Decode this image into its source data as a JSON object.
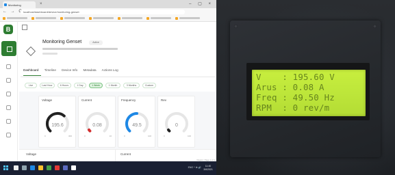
{
  "browser": {
    "tab_title": "Monitoring",
    "close_glyph": "×",
    "window_controls": "– ▢ ×",
    "nav_glyphs": "← → C",
    "url": "localhost/dashboard/device/monitoring-genset"
  },
  "app": {
    "logo_letter": "B",
    "device_title": "Monitoring Genset",
    "status_chip": "Active",
    "tabs": [
      {
        "label": "Dashboard"
      },
      {
        "label": "Timeline"
      },
      {
        "label": "Device Info"
      },
      {
        "label": "Metadata"
      },
      {
        "label": "Actions Log"
      }
    ],
    "time_ranges": [
      {
        "label": "Live"
      },
      {
        "label": "Last Hour"
      },
      {
        "label": "6 Hours"
      },
      {
        "label": "1 Day"
      },
      {
        "label": "1 Week"
      },
      {
        "label": "1 Month"
      },
      {
        "label": "3 Months"
      },
      {
        "label": "Custom"
      }
    ],
    "gauges": [
      {
        "title": "Voltage",
        "value": "195.6",
        "min": "0",
        "max": "300",
        "fill": 0.65,
        "color": "#222222"
      },
      {
        "title": "Current",
        "value": "0.08",
        "min": "0",
        "max": "10",
        "fill": 0.01,
        "color": "#d32f2f"
      },
      {
        "title": "Frequency",
        "value": "49.5",
        "min": "0",
        "max": "100",
        "fill": 0.5,
        "color": "#1e88e5"
      },
      {
        "title": "Rev",
        "value": "0",
        "min": "0",
        "max": "100",
        "fill": 0.0,
        "color": "#222222"
      }
    ],
    "lower_left_label": "Voltage",
    "lower_right_label": "Current",
    "page_note": "Region: Page 1 of 1"
  },
  "taskbar": {
    "tray_text": "ENG ^ ⊕ 🔊",
    "clock_time": "11:40",
    "clock_date": "3/6/2021"
  },
  "lcd": {
    "lines": [
      {
        "label": "V",
        "sep": ":",
        "value": "195.60",
        "unit": "V"
      },
      {
        "label": "Arus",
        "sep": ":",
        "value": "0.08",
        "unit": "A"
      },
      {
        "label": "Freq",
        "sep": ":",
        "value": "49.50",
        "unit": "Hz"
      },
      {
        "label": "RPM",
        "sep": ":",
        "value": "0",
        "unit": "rev/m"
      }
    ],
    "backlight_color": "#c3ea3c",
    "text_color": "#5d7a1a"
  }
}
